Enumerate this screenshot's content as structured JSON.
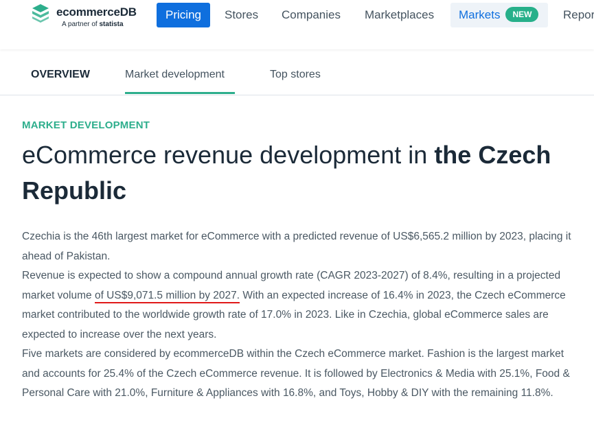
{
  "nav": {
    "logo_text": "ecommerceDB",
    "logo_partner_prefix": "A partner of",
    "logo_partner_name": "statista",
    "items": [
      "Pricing",
      "Stores",
      "Companies",
      "Marketplaces",
      "Markets",
      "Repor"
    ],
    "markets_badge": "NEW"
  },
  "subtabs": [
    "OVERVIEW",
    "Market development",
    "Top stores"
  ],
  "section_label": "MARKET DEVELOPMENT",
  "heading": {
    "normal": "eCommerce revenue development in ",
    "bold": "the Czech Republic"
  },
  "paragraphs": {
    "p1": "Czechia is the 46th largest market for eCommerce with a predicted revenue of US$6,565.2 million by 2023, placing it ahead of Pakistan.",
    "p2_before": "Revenue is expected to show a compound annual growth rate (CAGR 2023-2027) of 8.4%, resulting in a projected market volume ",
    "p2_highlight": "of US$9,071.5 million by 2027.",
    "p2_after": " With an expected increase of 16.4% in 2023, the Czech eCommerce market contributed to the worldwide growth rate of 17.0% in 2023. Like in Czechia, global eCommerce sales are expected to increase over the next years.",
    "p3": "Five markets are considered by ecommerceDB within the Czech eCommerce market. Fashion is the largest market and accounts for 25.4% of the Czech eCommerce revenue. It is followed by Electronics & Media with 25.1%, Food & Personal Care with 21.0%, Furniture & Appliances with 16.8%, and Toys, Hobby & DIY with the remaining 11.8%."
  },
  "colors": {
    "accent_green": "#2dae8c",
    "pricing_blue": "#0f6fde",
    "highlight_red": "#e01818"
  }
}
